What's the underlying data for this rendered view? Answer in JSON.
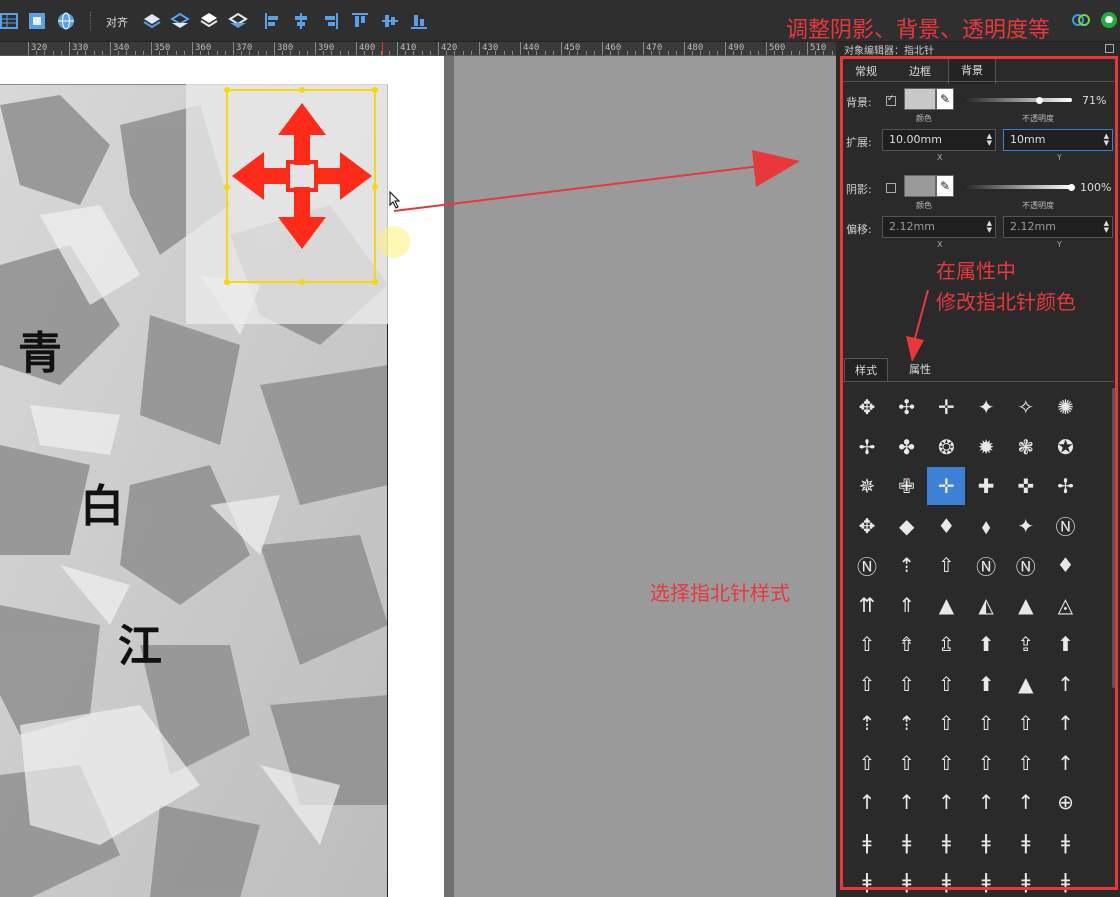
{
  "toolbar": {
    "align_label": "对齐",
    "buttons": [
      "table-icon",
      "frame-icon",
      "globe-icon",
      "layer-up-icon",
      "layer-down-icon",
      "layer-top-icon",
      "layer-bottom-icon",
      "align-left-icon",
      "align-center-h-icon",
      "align-right-icon",
      "align-top-icon",
      "align-center-v-icon",
      "align-bottom-icon"
    ]
  },
  "ruler": {
    "labels": [
      "320",
      "330",
      "340",
      "350",
      "360",
      "370",
      "380",
      "390",
      "400",
      "410",
      "420",
      "430",
      "440",
      "450",
      "460",
      "470",
      "480",
      "490",
      "500",
      "510"
    ]
  },
  "map": {
    "chars": [
      "青",
      "白",
      "江"
    ]
  },
  "annotations": {
    "top": "调整阴影、背景、透明度等",
    "property_line1": "在属性中",
    "property_line2": "修改指北针颜色",
    "style": "选择指北针样式"
  },
  "panel": {
    "title": "对象编辑器：指北针",
    "tabs": [
      "常规",
      "边框",
      "背景"
    ],
    "active_tab": "背景",
    "background": {
      "label": "背景:",
      "checked": true,
      "color": "#c8c8c8",
      "color_caption": "颜色",
      "opacity_caption": "不透明度",
      "opacity": "71%",
      "opacity_value": 0.71
    },
    "extend": {
      "label": "扩展:",
      "x_value": "10.00mm",
      "y_value": "10mm",
      "x_caption": "X",
      "y_caption": "Y"
    },
    "shadow": {
      "label": "阴影:",
      "checked": false,
      "color": "#9a9a9a",
      "color_caption": "颜色",
      "opacity_caption": "不透明度",
      "opacity": "100%",
      "opacity_value": 1.0
    },
    "offset": {
      "label": "偏移:",
      "x_value": "2.12mm",
      "y_value": "2.12mm",
      "x_caption": "X",
      "y_caption": "Y"
    },
    "lower_tabs": [
      "样式",
      "属性"
    ],
    "lower_active": "样式",
    "styles_grid": [
      [
        "✥",
        "✣",
        "✛",
        "✦",
        "✧",
        "✺"
      ],
      [
        "✢",
        "✤",
        "❂",
        "✹",
        "❃",
        "✪"
      ],
      [
        "✵",
        "✙",
        "✛",
        "✚",
        "✜",
        "✢"
      ],
      [
        "✥",
        "◆",
        "♦",
        "⬧",
        "✦",
        "Ⓝ"
      ],
      [
        "Ⓝ",
        "⇡",
        "⇧",
        "Ⓝ",
        "Ⓝ",
        "♦"
      ],
      [
        "⇈",
        "⇑",
        "▲",
        "◭",
        "▲",
        "◬"
      ],
      [
        "⇧",
        "⇮",
        "⇫",
        "⬆",
        "⇪",
        "⬆"
      ],
      [
        "⇧",
        "⇧",
        "⇧",
        "⬆",
        "▲",
        "↑"
      ],
      [
        "⇡",
        "⇡",
        "⇧",
        "⇧",
        "⇧",
        "↑"
      ],
      [
        "⇧",
        "⇧",
        "⇧",
        "⇧",
        "⇧",
        "↑"
      ],
      [
        "↑",
        "↑",
        "↑",
        "↑",
        "↑",
        "⊕"
      ],
      [
        "ǂ",
        "ǂ",
        "ǂ",
        "ǂ",
        "ǂ",
        "ǂ"
      ],
      [
        "ǂ",
        "ǂ",
        "ǂ",
        "ǂ",
        "ǂ",
        "ǂ"
      ]
    ],
    "selected_style": [
      2,
      2
    ]
  },
  "colors": {
    "annotation": "#e8383c",
    "selection": "#f5d90a",
    "compass": "#ff2a17",
    "accent": "#3d82d6"
  }
}
